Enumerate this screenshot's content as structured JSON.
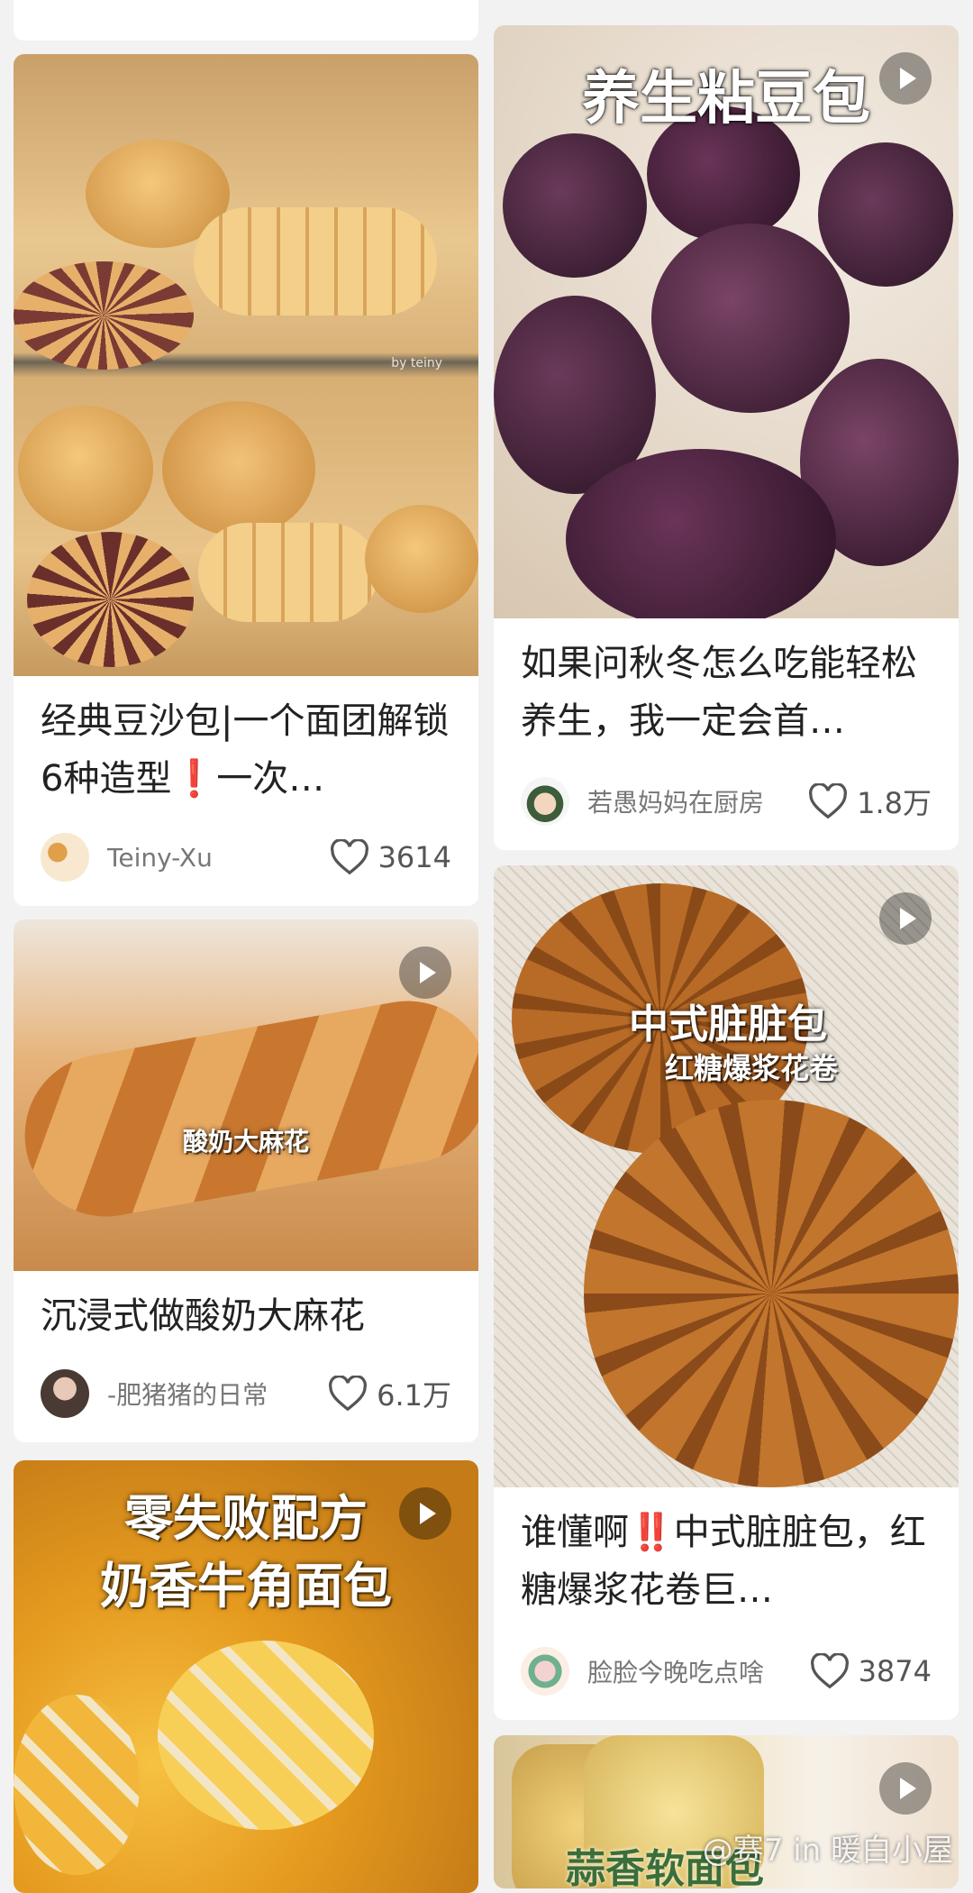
{
  "feed": {
    "left": [
      {
        "title": "经典豆沙包|一个面团解锁6种造型❗️一次…",
        "author": "Teiny-Xu",
        "likes": "3614",
        "image_watermark": "by teiny",
        "has_video": false
      },
      {
        "title": "沉浸式做酸奶大麻花",
        "author": "-肥猪猪的日常",
        "likes": "6.1万",
        "image_caption": "酸奶大麻花",
        "has_video": true
      },
      {
        "image_caption_line1": "零失败配方",
        "image_caption_line2": "奶香牛角面包",
        "has_video": true
      }
    ],
    "right": [
      {
        "title": "如果问秋冬怎么吃能轻松养生，我一定会首…",
        "author": "若愚妈妈在厨房",
        "likes": "1.8万",
        "image_caption": "养生粘豆包",
        "has_video": true
      },
      {
        "title": "谁懂啊‼️中式脏脏包，红糖爆浆花卷巨…",
        "author": "脸脸今晚吃点啥",
        "likes": "3874",
        "image_caption_line1": "中式脏脏包",
        "image_caption_line2": "红糖爆浆花卷",
        "has_video": true
      },
      {
        "image_caption": "蒜香软面包",
        "has_video": true
      }
    ]
  },
  "watermark": "@赛7 in 暖白小屋",
  "icons": {
    "like": "heart-outline-icon",
    "play": "play-icon"
  },
  "colors": {
    "background": "#f2f2f2",
    "card": "#ffffff",
    "text": "#222222",
    "meta": "#777777"
  }
}
